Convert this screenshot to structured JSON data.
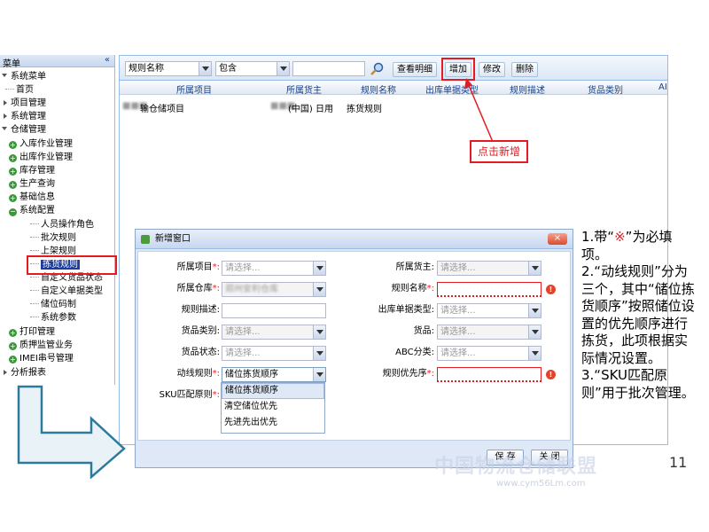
{
  "sidebar": {
    "title": "菜单",
    "collapse": "«",
    "items": [
      {
        "label": "系统菜单"
      },
      {
        "label": "首页"
      },
      {
        "label": "项目管理"
      },
      {
        "label": "系统管理"
      },
      {
        "label": "仓储管理"
      },
      {
        "label": "入库作业管理"
      },
      {
        "label": "出库作业管理"
      },
      {
        "label": "库存管理"
      },
      {
        "label": "生产查询"
      },
      {
        "label": "基础信息"
      },
      {
        "label": "系统配置"
      },
      {
        "label": "人员操作角色"
      },
      {
        "label": "批次规则"
      },
      {
        "label": "上架规则"
      },
      {
        "label": "拣货规则"
      },
      {
        "label": "自定义货品状态"
      },
      {
        "label": "自定义单据类型"
      },
      {
        "label": "储位码制"
      },
      {
        "label": "系统参数"
      },
      {
        "label": "打印管理"
      },
      {
        "label": "质押监管业务"
      },
      {
        "label": "IMEI串号管理"
      },
      {
        "label": "分析报表"
      }
    ]
  },
  "toolbar": {
    "field_select": "规则名称",
    "op_select": "包含",
    "search_value": "",
    "view_detail": "查看明细",
    "add": "增加",
    "edit": "修改",
    "delete": "删除"
  },
  "grid": {
    "columns": [
      "所属项目",
      "所属货主",
      "规则名称",
      "出库单据类型",
      "规则描述",
      "货品类别",
      "AI"
    ],
    "rows": [
      {
        "project": "输仓储项目",
        "owner": "(中国) 日用",
        "rule_name": "拣货规则"
      }
    ]
  },
  "callout": "点击新增",
  "dialog": {
    "title": "新增窗口",
    "close": "×",
    "labels": {
      "project": "所属项目",
      "owner": "所属货主:",
      "warehouse": "所属仓库",
      "rule_name": "规则名称",
      "rule_desc": "规则描述:",
      "outbound_type": "出库单据类型:",
      "goods_category": "货品类别:",
      "goods": "货品:",
      "goods_status": "货品状态:",
      "abc": "ABC分类:",
      "route_rule": "动线规则",
      "rule_priority": "规则优先序",
      "sku_rule": "SKU匹配原则",
      "req": "*:",
      "req_star": "*"
    },
    "values": {
      "project": "请选择...",
      "owner": "请选择...",
      "warehouse": "郑州安利仓库",
      "rule_name": "",
      "rule_desc": "",
      "outbound_type": "请选择...",
      "goods_category": "请选择...",
      "goods": "请选择...",
      "goods_status": "请选择...",
      "abc": "请选择...",
      "route_rule": "储位拣货顺序",
      "rule_priority": ""
    },
    "dropdown_options": [
      "储位拣货顺序",
      "清空储位优先",
      "先进先出优先"
    ],
    "save": "保 存",
    "close_btn": "关 闭"
  },
  "notes": {
    "line1a": "1.带“",
    "line1b": "※",
    "line1c": "”为必填项。",
    "line2": "2.“动线规则”分为三个，其中“储位拣货顺序”按照储位设置的优先顺序进行拣货，此项根据实际情况设置。",
    "line3": "3.“SKU匹配原则”用于批次管理。"
  },
  "watermark": "中国物流仓储联盟",
  "watermark_url": "www.cym56Lm.com",
  "page_number": "11"
}
